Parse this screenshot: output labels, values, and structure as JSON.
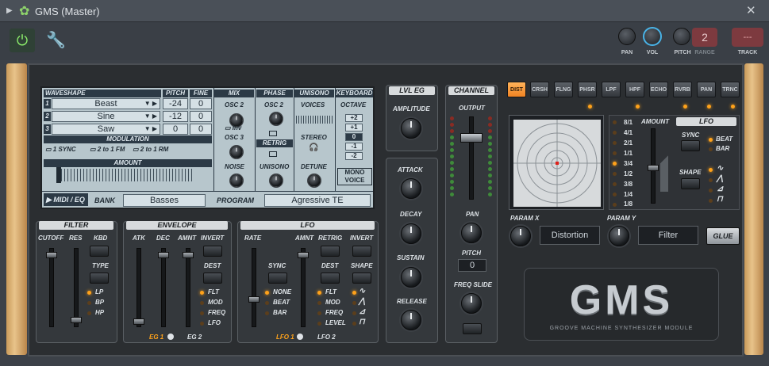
{
  "window": {
    "title": "GMS (Master)"
  },
  "toolbar": {
    "pan_label": "PAN",
    "vol_label": "VOL",
    "pitch_label": "PITCH",
    "range_label": "RANGE",
    "range_value": "2",
    "track_label": "TRACK",
    "track_value": "---"
  },
  "lcd": {
    "headers": {
      "waveshape": "WAVESHAPE",
      "pitch": "PITCH",
      "fine": "FINE",
      "mix": "MIX",
      "phase": "PHASE",
      "unisono": "UNISONO",
      "keyboard": "KEYBOARD"
    },
    "osc": [
      {
        "num": "1",
        "wave": "Beast",
        "pitch": "-24",
        "fine": "0"
      },
      {
        "num": "2",
        "wave": "Sine",
        "pitch": "-12",
        "fine": "0"
      },
      {
        "num": "3",
        "wave": "Saw",
        "pitch": "0",
        "fine": "0"
      }
    ],
    "modulation": {
      "header": "MODULATION",
      "opt1": "1 SYNC",
      "opt2": "2 to 1 FM",
      "opt3": "2 to 1 RM",
      "amount": "AMOUNT"
    },
    "mix": {
      "osc2": "OSC 2",
      "inv": "Inv",
      "osc3": "OSC 3",
      "noise": "NOISE"
    },
    "phase": {
      "osc2": "OSC 2",
      "retrig": "RETRIG",
      "unisono": "UNISONO"
    },
    "unisono": {
      "voices": "VOICES",
      "stereo": "STEREO",
      "detune": "DETUNE"
    },
    "keyboard": {
      "octave": "OCTAVE",
      "oct": [
        "+2",
        "+1",
        "0",
        "-1",
        "-2"
      ],
      "mono": "MONO",
      "voice": "VOICE"
    },
    "bottom": {
      "midi": "MIDI / EQ",
      "bank_label": "BANK",
      "bank_value": "Basses",
      "program_label": "PROGRAM",
      "program_value": "Agressive TE"
    }
  },
  "filter": {
    "title": "FILTER",
    "cutoff": "CUTOFF",
    "res": "RES",
    "kbd": "KBD",
    "type": "TYPE",
    "types": [
      "LP",
      "BP",
      "HP"
    ]
  },
  "envelope": {
    "title": "ENVELOPE",
    "atk": "ATK",
    "dec": "DEC",
    "amnt": "AMNT",
    "invert": "INVERT",
    "dest": "DEST",
    "dests": [
      "FLT",
      "MOD",
      "FREQ",
      "LFO"
    ],
    "eg1": "EG 1",
    "eg2": "EG 2"
  },
  "lfo": {
    "title": "LFO",
    "rate": "RATE",
    "amnt": "AMNT",
    "retrig": "RETRIG",
    "invert": "INVERT",
    "sync": "SYNC",
    "sync_opts": [
      "NONE",
      "BEAT",
      "BAR"
    ],
    "dest": "DEST",
    "dests": [
      "FLT",
      "MOD",
      "FREQ",
      "LEVEL"
    ],
    "shape": "SHAPE",
    "lfo1": "LFO 1",
    "lfo2": "LFO 2"
  },
  "lvl_eg": {
    "title": "LVL EG",
    "amplitude": "AMPLITUDE",
    "attack": "ATTACK",
    "decay": "DECAY",
    "sustain": "SUSTAIN",
    "release": "RELEASE"
  },
  "channel": {
    "title": "CHANNEL",
    "output": "OUTPUT",
    "pan": "PAN",
    "pitch": "PITCH",
    "pitch_value": "0",
    "freq_slide": "FREQ SLIDE"
  },
  "fx": {
    "buttons": [
      "DIST",
      "CRSH",
      "FLNG",
      "PHSR",
      "LPF",
      "HPF",
      "ECHO",
      "RVRB",
      "PAN",
      "TRNC"
    ],
    "rates": [
      "8/1",
      "4/1",
      "2/1",
      "1/1",
      "3/4",
      "1/2",
      "3/8",
      "1/4",
      "1/8"
    ],
    "amount": "AMOUNT",
    "lfo": "LFO",
    "sync": "SYNC",
    "beat": "BEAT",
    "bar": "BAR",
    "shape": "SHAPE",
    "param_x": "PARAM X",
    "param_x_value": "Distortion",
    "param_y": "PARAM Y",
    "param_y_value": "Filter",
    "glue": "GLUE"
  },
  "logo": {
    "text": "GMS",
    "subtitle": "GROOVE MACHINE SYNTHESIZER MODULE"
  },
  "colors": {
    "accent": "#ffa21a",
    "lcd": "#b7c6cc",
    "vol_ring": "#49b4e8"
  }
}
